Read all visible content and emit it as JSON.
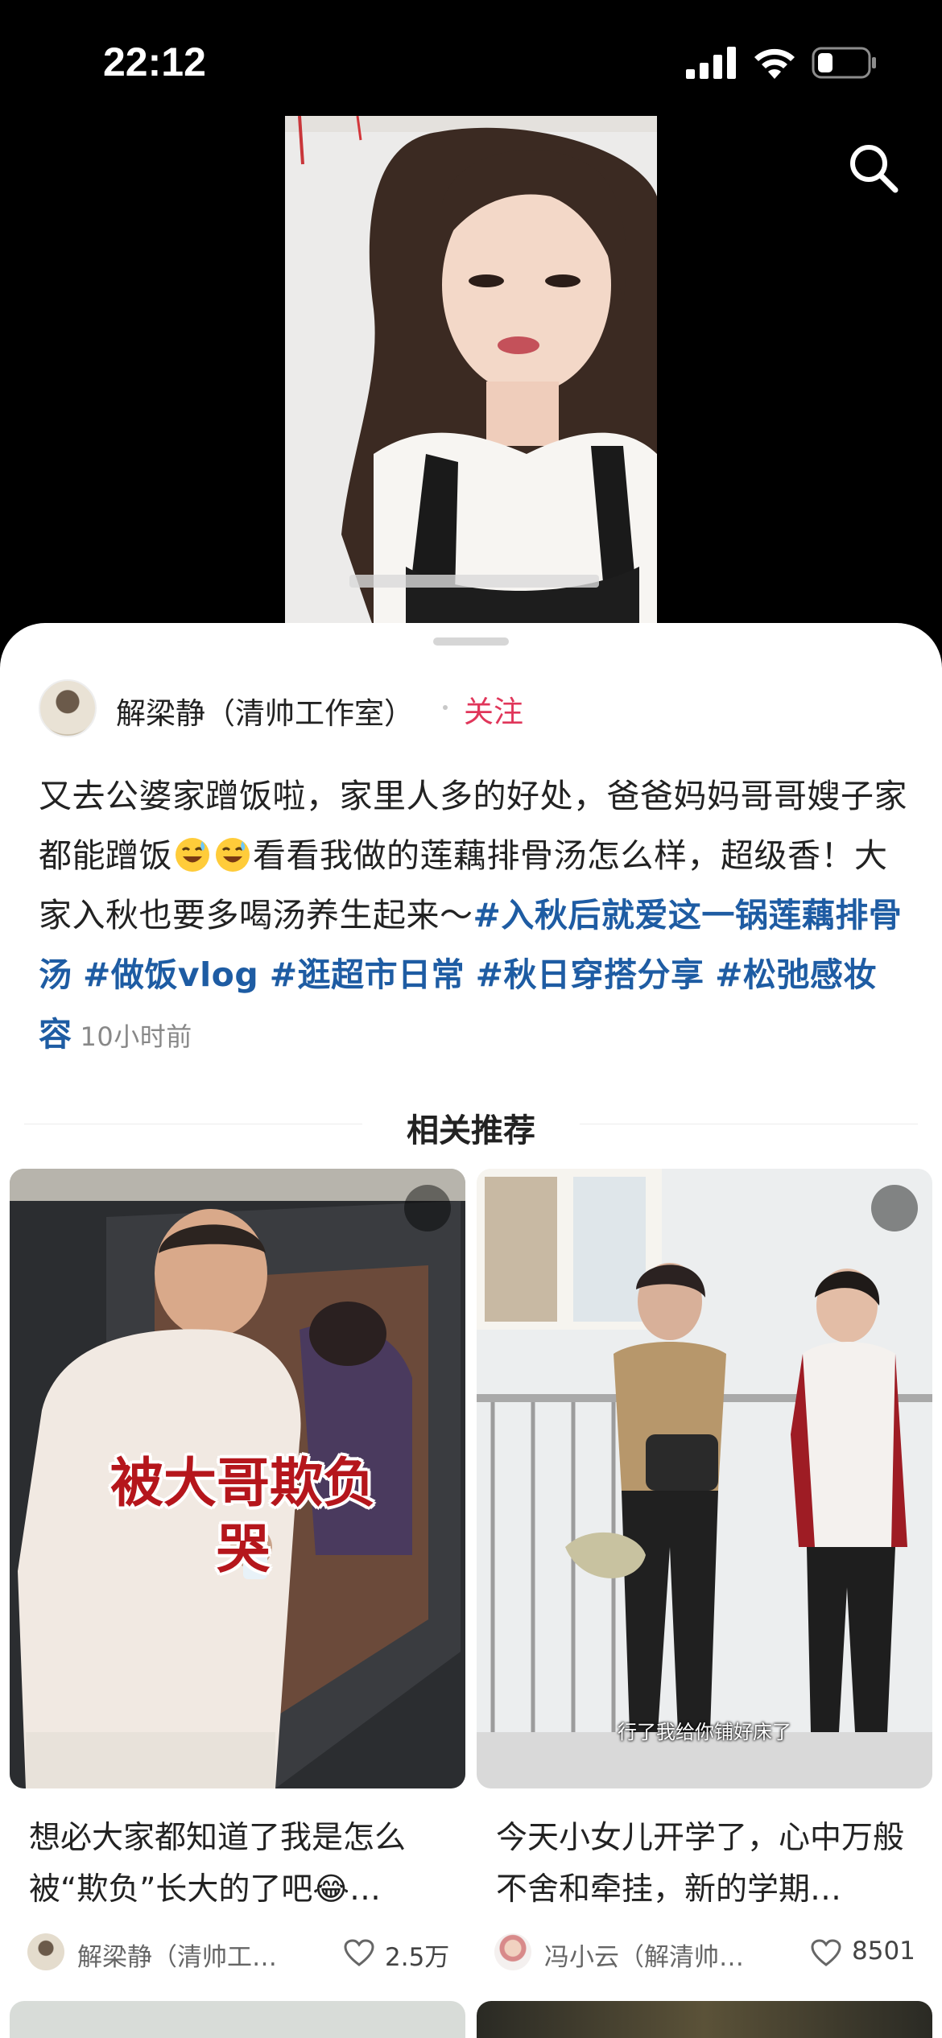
{
  "status_bar": {
    "time": "22:12"
  },
  "post": {
    "author_name": "解梁静（清帅工作室）",
    "follow_label": "关注",
    "text_part1": "又去公婆家蹭饭啦，家里人多的好处，爸爸妈妈哥哥嫂子家都能蹭饭",
    "text_part2": "看看我做的莲藕排骨汤怎么样，超级香！大家入秋也要多喝汤养生起来～",
    "hashtags": [
      "#入秋后就爱这一锅莲藕排骨汤",
      "#做饭vlog",
      "#逛超市日常",
      "#秋日穿搭分享",
      "#松弛感妆容"
    ],
    "time_ago": "10小时前"
  },
  "recommendations": {
    "section_title": "相关推荐",
    "items": [
      {
        "overlay_title_line1": "被大哥欺负",
        "overlay_title_line2": "哭",
        "title": "想必大家都知道了我是怎么被“欺负”长大的了吧😂…",
        "author": "解梁静（清帅工…",
        "likes": "2.5万"
      },
      {
        "caption": "行了我给你铺好床了",
        "title": "今天小女儿开学了，心中万般不舍和牵挂，新的学期…",
        "author": "冯小云（解清帅…",
        "likes": "8501"
      }
    ]
  },
  "icons": {
    "status": [
      "signal-icon",
      "wifi-icon",
      "battery-icon"
    ],
    "header": "search-icon",
    "cards": [
      "play-icon",
      "heart-icon"
    ],
    "emoji": "sweat-smile-emoji"
  },
  "colors": {
    "follow": "#e0365a",
    "hashtag": "#1e5ca3",
    "overlay_title": "#b5161c"
  }
}
